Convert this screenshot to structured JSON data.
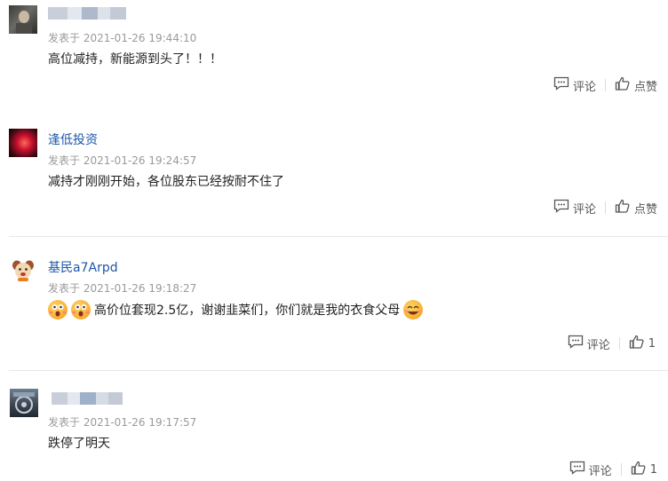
{
  "comments": [
    {
      "author": "",
      "time": "发表于 2021-01-26 19:44:10",
      "content": "高位减持，新能源到头了！！！",
      "comment_label": "评论",
      "like_label": "点赞"
    },
    {
      "author": "逢低投资",
      "time": "发表于 2021-01-26 19:24:57",
      "content": "减持才刚刚开始，各位股东已经按耐不住了",
      "comment_label": "评论",
      "like_label": "点赞"
    },
    {
      "author": "基民a7Arpd",
      "time": "发表于 2021-01-26 19:18:27",
      "content": "高价位套现2.5亿，谢谢韭菜们，你们就是我的衣食父母",
      "comment_label": "评论",
      "like_label": "1"
    },
    {
      "author": "",
      "time": "发表于 2021-01-26 19:17:57",
      "content": "跌停了明天",
      "comment_label": "评论",
      "like_label": "1"
    }
  ],
  "icons": {
    "comment": "comment-bubble-icon",
    "like": "thumbs-up-icon",
    "emoji_surprised": "surprised-face-emoji",
    "emoji_smile": "smiling-face-emoji"
  },
  "colors": {
    "author": "#1d57a8",
    "time": "#9a9a9a",
    "text": "#222222",
    "divider": "#e6e6e6"
  }
}
